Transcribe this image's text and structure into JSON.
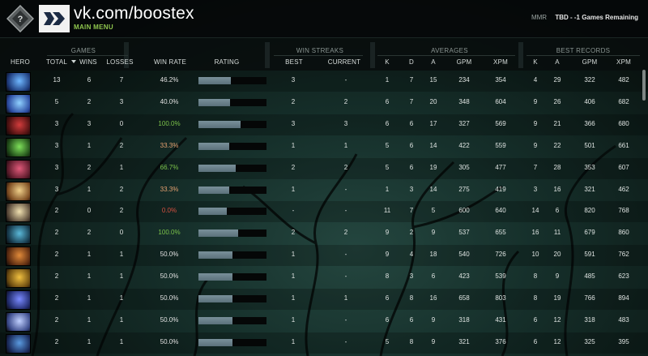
{
  "topbar": {
    "username": "vk.com/boostex",
    "main_menu": "MAIN MENU",
    "mmr_label": "MMR",
    "mmr_value": "TBD - -1 Games Remaining",
    "colors": {
      "accent": "#8fc64e"
    }
  },
  "header": {
    "groups": {
      "games": "GAMES",
      "win_streaks": "WIN STREAKS",
      "averages": "AVERAGES",
      "best_records": "BEST RECORDS"
    },
    "columns": {
      "hero": "HERO",
      "total": "TOTAL",
      "wins": "WINS",
      "losses": "LOSSES",
      "win_rate": "WIN RATE",
      "rating": "RATING",
      "best": "BEST",
      "current": "CURRENT",
      "avg_k": "K",
      "avg_d": "D",
      "avg_a": "A",
      "avg_gpm": "GPM",
      "avg_xpm": "XPM",
      "best_k": "K",
      "best_a": "A",
      "best_gpm": "GPM",
      "best_xpm": "XPM"
    }
  },
  "rows": [
    {
      "hero": "hero-portrait-1",
      "total": "13",
      "wins": "6",
      "losses": "7",
      "win_rate": "46.2%",
      "wr_class": "wr-mid",
      "rating": 0.48,
      "best": "3",
      "current": "-",
      "k": "1",
      "d": "7",
      "a": "15",
      "gpm": "234",
      "xpm": "354",
      "bk": "4",
      "ba": "29",
      "bgpm": "322",
      "bxpm": "482"
    },
    {
      "hero": "hero-portrait-2",
      "total": "5",
      "wins": "2",
      "losses": "3",
      "win_rate": "40.0%",
      "wr_class": "wr-mid",
      "rating": 0.47,
      "best": "2",
      "current": "2",
      "k": "6",
      "d": "7",
      "a": "20",
      "gpm": "348",
      "xpm": "604",
      "bk": "9",
      "ba": "26",
      "bgpm": "406",
      "bxpm": "682"
    },
    {
      "hero": "hero-portrait-3",
      "total": "3",
      "wins": "3",
      "losses": "0",
      "win_rate": "100.0%",
      "wr_class": "wr-good",
      "rating": 0.62,
      "best": "3",
      "current": "3",
      "k": "6",
      "d": "6",
      "a": "17",
      "gpm": "327",
      "xpm": "569",
      "bk": "9",
      "ba": "21",
      "bgpm": "366",
      "bxpm": "680"
    },
    {
      "hero": "hero-portrait-4",
      "total": "3",
      "wins": "1",
      "losses": "2",
      "win_rate": "33.3%",
      "wr_class": "wr-alt",
      "rating": 0.45,
      "best": "1",
      "current": "1",
      "k": "5",
      "d": "6",
      "a": "14",
      "gpm": "422",
      "xpm": "559",
      "bk": "9",
      "ba": "22",
      "bgpm": "501",
      "bxpm": "661"
    },
    {
      "hero": "hero-portrait-5",
      "total": "3",
      "wins": "2",
      "losses": "1",
      "win_rate": "66.7%",
      "wr_class": "wr-good",
      "rating": 0.55,
      "best": "2",
      "current": "2",
      "k": "5",
      "d": "6",
      "a": "19",
      "gpm": "305",
      "xpm": "477",
      "bk": "7",
      "ba": "28",
      "bgpm": "353",
      "bxpm": "607"
    },
    {
      "hero": "hero-portrait-6",
      "total": "3",
      "wins": "1",
      "losses": "2",
      "win_rate": "33.3%",
      "wr_class": "wr-alt",
      "rating": 0.45,
      "best": "1",
      "current": "-",
      "k": "1",
      "d": "3",
      "a": "14",
      "gpm": "275",
      "xpm": "419",
      "bk": "3",
      "ba": "16",
      "bgpm": "321",
      "bxpm": "462"
    },
    {
      "hero": "hero-portrait-7",
      "total": "2",
      "wins": "0",
      "losses": "2",
      "win_rate": "0.0%",
      "wr_class": "wr-bad",
      "rating": 0.42,
      "best": "-",
      "current": "-",
      "k": "11",
      "d": "7",
      "a": "5",
      "gpm": "600",
      "xpm": "640",
      "bk": "14",
      "ba": "6",
      "bgpm": "820",
      "bxpm": "768"
    },
    {
      "hero": "hero-portrait-8",
      "total": "2",
      "wins": "2",
      "losses": "0",
      "win_rate": "100.0%",
      "wr_class": "wr-good",
      "rating": 0.58,
      "best": "2",
      "current": "2",
      "k": "9",
      "d": "2",
      "a": "9",
      "gpm": "537",
      "xpm": "655",
      "bk": "16",
      "ba": "11",
      "bgpm": "679",
      "bxpm": "860"
    },
    {
      "hero": "hero-portrait-9",
      "total": "2",
      "wins": "1",
      "losses": "1",
      "win_rate": "50.0%",
      "wr_class": "wr-mid",
      "rating": 0.5,
      "best": "1",
      "current": "-",
      "k": "9",
      "d": "4",
      "a": "18",
      "gpm": "540",
      "xpm": "726",
      "bk": "10",
      "ba": "20",
      "bgpm": "591",
      "bxpm": "762"
    },
    {
      "hero": "hero-portrait-10",
      "total": "2",
      "wins": "1",
      "losses": "1",
      "win_rate": "50.0%",
      "wr_class": "wr-mid",
      "rating": 0.5,
      "best": "1",
      "current": "-",
      "k": "8",
      "d": "3",
      "a": "6",
      "gpm": "423",
      "xpm": "539",
      "bk": "8",
      "ba": "9",
      "bgpm": "485",
      "bxpm": "623"
    },
    {
      "hero": "hero-portrait-11",
      "total": "2",
      "wins": "1",
      "losses": "1",
      "win_rate": "50.0%",
      "wr_class": "wr-mid",
      "rating": 0.5,
      "best": "1",
      "current": "1",
      "k": "6",
      "d": "8",
      "a": "16",
      "gpm": "658",
      "xpm": "803",
      "bk": "8",
      "ba": "19",
      "bgpm": "766",
      "bxpm": "894"
    },
    {
      "hero": "hero-portrait-12",
      "total": "2",
      "wins": "1",
      "losses": "1",
      "win_rate": "50.0%",
      "wr_class": "wr-mid",
      "rating": 0.5,
      "best": "1",
      "current": "-",
      "k": "6",
      "d": "6",
      "a": "9",
      "gpm": "318",
      "xpm": "431",
      "bk": "6",
      "ba": "12",
      "bgpm": "318",
      "bxpm": "483"
    },
    {
      "hero": "hero-portrait-13",
      "total": "2",
      "wins": "1",
      "losses": "1",
      "win_rate": "50.0%",
      "wr_class": "wr-mid",
      "rating": 0.5,
      "best": "1",
      "current": "-",
      "k": "5",
      "d": "8",
      "a": "9",
      "gpm": "321",
      "xpm": "376",
      "bk": "6",
      "ba": "12",
      "bgpm": "325",
      "bxpm": "395"
    }
  ]
}
